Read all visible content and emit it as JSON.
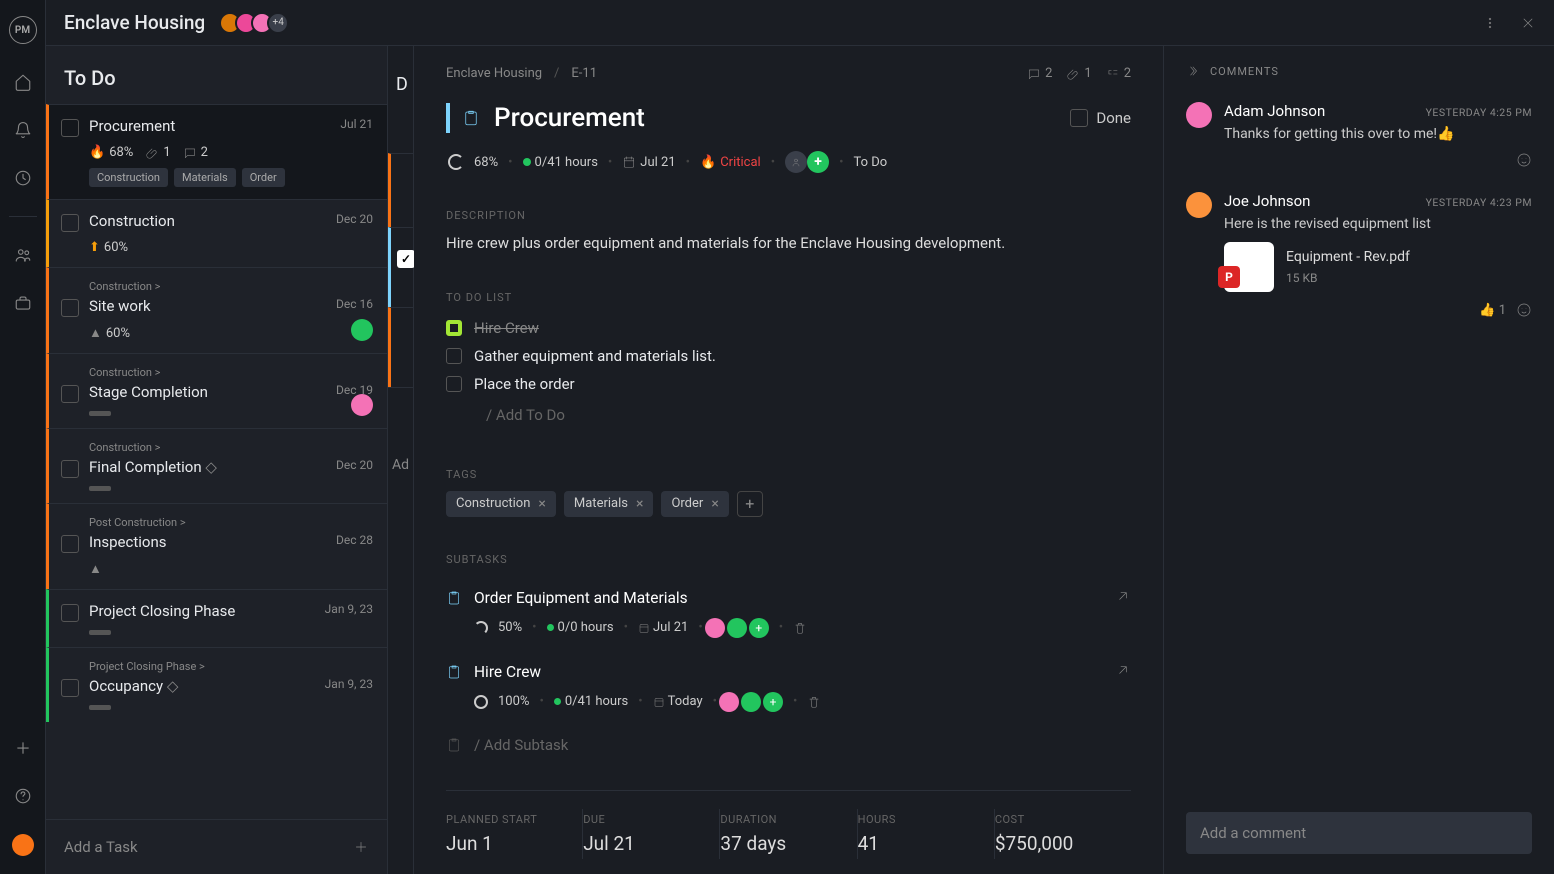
{
  "app_logo": "PM",
  "project_title": "Enclave Housing",
  "avatar_more": "+4",
  "column_title": "To Do",
  "peek_column_letter": "D",
  "peek_add": "Ad",
  "add_task_label": "Add a Task",
  "tasks": [
    {
      "title": "Procurement",
      "date": "Jul 21",
      "pct": "68%",
      "attach": "1",
      "comments": "2",
      "tags": [
        "Construction",
        "Materials",
        "Order"
      ],
      "color": "#f97316",
      "icon": "flame"
    },
    {
      "title": "Construction",
      "date": "Dec 20",
      "pct": "60%",
      "color": "#f59e0b",
      "icon": "up"
    },
    {
      "crumb": "Construction >",
      "title": "Site work",
      "date": "Dec 16",
      "pct": "60%",
      "color": "#f97316",
      "icon": "tri",
      "avatar": "#22c55e"
    },
    {
      "crumb": "Construction >",
      "title": "Stage Completion",
      "date": "Dec 19",
      "color": "#f97316",
      "bar": true,
      "avatar": "#f472b6"
    },
    {
      "crumb": "Construction >",
      "title": "Final Completion",
      "date": "Dec 20",
      "color": "#f97316",
      "bar": true,
      "diamond": true
    },
    {
      "crumb": "Post Construction >",
      "title": "Inspections",
      "date": "Dec 28",
      "color": "#f97316",
      "icon": "tri"
    },
    {
      "title": "Project Closing Phase",
      "date": "Jan 9, 23",
      "color": "#22c55e",
      "bar": true
    },
    {
      "crumb": "Project Closing Phase >",
      "title": "Occupancy",
      "date": "Jan 9, 23",
      "color": "#22c55e",
      "bar": true,
      "diamond": true
    }
  ],
  "breadcrumb": {
    "project": "Enclave Housing",
    "id": "E-11",
    "comments": "2",
    "attachments": "1",
    "subtasks": "2"
  },
  "detail": {
    "title": "Procurement",
    "done_label": "Done",
    "pct": "68%",
    "hours_spent": "0",
    "hours_total": "/41 hours",
    "due": "Jul 21",
    "priority": "Critical",
    "status": "To Do",
    "description": "Hire crew plus order equipment and materials for the Enclave Housing development.",
    "todos": [
      {
        "label": "Hire Crew",
        "done": true
      },
      {
        "label": "Gather equipment and materials list.",
        "done": false
      },
      {
        "label": "Place the order",
        "done": false
      }
    ],
    "todo_add": "/ Add To Do",
    "tags": [
      "Construction",
      "Materials",
      "Order"
    ],
    "subtasks": [
      {
        "title": "Order Equipment and Materials",
        "pct": "50%",
        "hours": "0",
        "hours_total": "/0 hours",
        "date": "Jul 21",
        "ring": "half"
      },
      {
        "title": "Hire Crew",
        "pct": "100%",
        "hours": "0",
        "hours_total": "/41 hours",
        "date": "Today",
        "ring": "empty"
      }
    ],
    "subtask_add": "/ Add Subtask",
    "planned": [
      {
        "label": "PLANNED START",
        "value": "Jun 1"
      },
      {
        "label": "DUE",
        "value": "Jul 21"
      },
      {
        "label": "DURATION",
        "value": "37 days"
      },
      {
        "label": "HOURS",
        "value": "41"
      },
      {
        "label": "COST",
        "value": "$750,000"
      }
    ]
  },
  "labels": {
    "description": "DESCRIPTION",
    "todo_list": "TO DO LIST",
    "tags": "TAGS",
    "subtasks": "SUBTASKS",
    "comments": "COMMENTS"
  },
  "comments": [
    {
      "name": "Adam Johnson",
      "time": "YESTERDAY 4:25 PM",
      "text": "Thanks for getting this over to me!👍",
      "avatar": "#f472b6"
    },
    {
      "name": "Joe Johnson",
      "time": "YESTERDAY 4:23 PM",
      "text": "Here is the revised equipment list",
      "avatar": "#fb923c",
      "attachment": {
        "name": "Equipment - Rev.pdf",
        "size": "15 KB",
        "badge": "P"
      },
      "reaction": {
        "emoji": "👍",
        "count": "1"
      }
    }
  ],
  "comment_placeholder": "Add a comment"
}
